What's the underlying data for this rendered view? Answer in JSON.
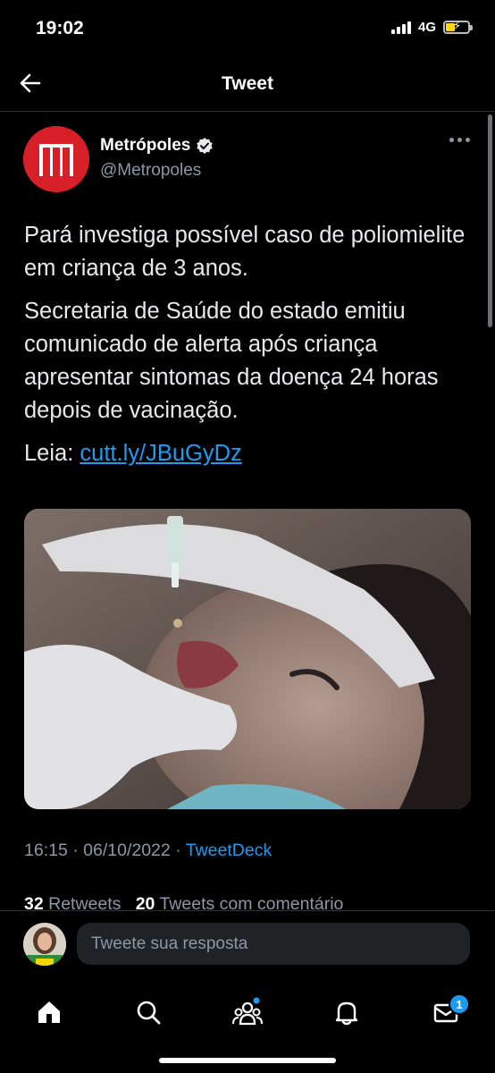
{
  "status_bar": {
    "time": "19:02",
    "network": "4G"
  },
  "nav": {
    "title": "Tweet"
  },
  "tweet": {
    "author_name": "Metrópoles",
    "author_handle": "@Metropoles",
    "paragraphs": [
      "Pará investiga possível caso de poliomielite em criança de 3 anos.",
      "Secretaria de Saúde do estado emitiu comunicado de alerta após criança apresentar sintomas da doença 24 horas depois de vacinação."
    ],
    "link_prefix": "Leia: ",
    "link_text": "cutt.ly/JBuGyDz",
    "time": "16:15",
    "date": "06/10/2022",
    "separator": "·",
    "source": "TweetDeck",
    "retweets_count": "32",
    "retweets_label": "Retweets",
    "quotes_count": "20",
    "quotes_label": "Tweets com comentário"
  },
  "reply": {
    "placeholder": "Tweete sua resposta"
  },
  "tabbar": {
    "messages_badge": "1"
  },
  "colors": {
    "accent": "#1d9bf0",
    "brand": "#d61f26",
    "background": "#000000"
  }
}
